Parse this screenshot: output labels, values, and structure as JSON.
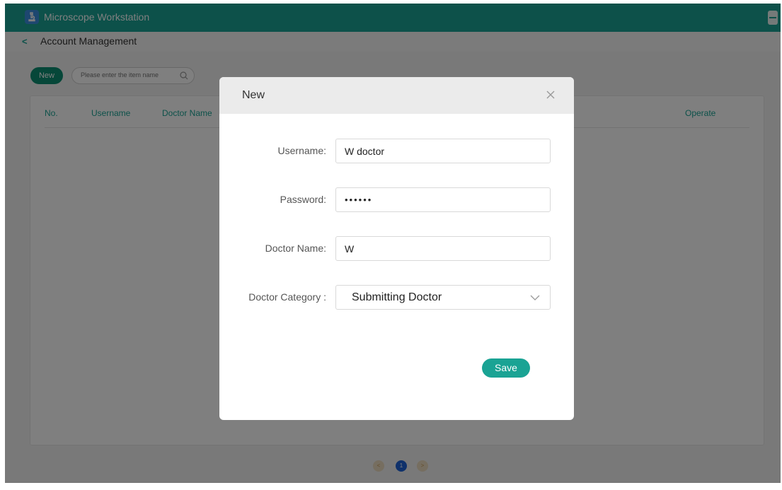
{
  "app": {
    "title": "Microscope Workstation"
  },
  "header": {
    "back_icon": "chevron-left-icon",
    "page_title": "Account Management"
  },
  "toolbar": {
    "new_label": "New",
    "search_placeholder": "Please enter the item name",
    "search_icon": "search-icon"
  },
  "table": {
    "columns": [
      "No.",
      "Username",
      "Doctor Name",
      "Operate"
    ],
    "rows": []
  },
  "pagination": {
    "prev_label": "<",
    "current_page": "1",
    "next_label": ">"
  },
  "modal": {
    "title": "New",
    "close_icon": "close-icon",
    "fields": {
      "username": {
        "label": "Username:",
        "value": "W doctor"
      },
      "password": {
        "label": "Password:",
        "value": "••••••"
      },
      "doctor_name": {
        "label": "Doctor Name:",
        "value": "W"
      },
      "doctor_category": {
        "label": "Doctor Category :",
        "value": "Submitting Doctor"
      }
    },
    "save_label": "Save"
  },
  "colors": {
    "accent": "#1aa394",
    "new_button": "#0d8f72",
    "page_active": "#1f63d6",
    "page_inactive": "#eddcc0"
  }
}
